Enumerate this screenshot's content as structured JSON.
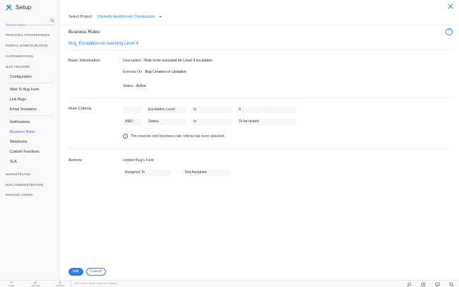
{
  "app": {
    "title": "Setup",
    "brand_color": "#2d7be8"
  },
  "sidebar": {
    "search_placeholder": "Search here",
    "sections": [
      {
        "label": "PERSONAL PREFERENCES"
      },
      {
        "label": "PORTAL CONFIGURATION"
      },
      {
        "label": "CUSTOMIZATION"
      },
      {
        "label": "BUG TRACKER"
      },
      {
        "label": "MARKETPLACE"
      },
      {
        "label": "DATA ADMINISTRATION"
      },
      {
        "label": "MANAGE USERS"
      }
    ],
    "items": [
      {
        "label": "Configuration"
      },
      {
        "label": "Web To Bug Form"
      },
      {
        "label": "Link Bugs"
      },
      {
        "label": "Email Templates"
      },
      {
        "label": "Notifications"
      },
      {
        "label": "Business Rules",
        "active": true
      },
      {
        "label": "Webhooks"
      },
      {
        "label": "Custom Functions"
      },
      {
        "label": "SLA"
      }
    ]
  },
  "project": {
    "label": "Select Project",
    "value": "Donnelly Apartments Construction"
  },
  "business_rules": {
    "title": "Business Rules",
    "rule_name": "Bug_Escalation-on reaching Level 4",
    "basic_info": {
      "heading": "Basic Information",
      "description_label": "Description :",
      "description": "Rule to be executed for Level 4 escalation",
      "execute_label": "Execute On :",
      "execute_value": "Bug Creation or Updation",
      "status_label": "Status :",
      "status_value": "Active"
    },
    "criteria": {
      "heading": "Rule Criteria",
      "rows": [
        {
          "connector": "",
          "field": "Escalation Level",
          "operator": "Is",
          "value": "4"
        },
        {
          "connector": "AND",
          "field": "Status",
          "operator": "Is",
          "value": "To be tested"
        }
      ],
      "info": "The execute next business rule criteria has been selected."
    },
    "actions": {
      "heading": "Actions",
      "subheading": "Update Bug's Field",
      "field": "Assigned To",
      "arrow": "→",
      "value": "Not Assigned"
    }
  },
  "buttons": {
    "edit": "Edit",
    "cancel": "Cancel"
  },
  "bottom_bar": {
    "items": [
      {
        "label": "Chats"
      },
      {
        "label": "Channels"
      },
      {
        "label": "Contacts"
      }
    ],
    "zia_placeholder": "Here is your Smart Chat (Ctrl+Space)"
  }
}
